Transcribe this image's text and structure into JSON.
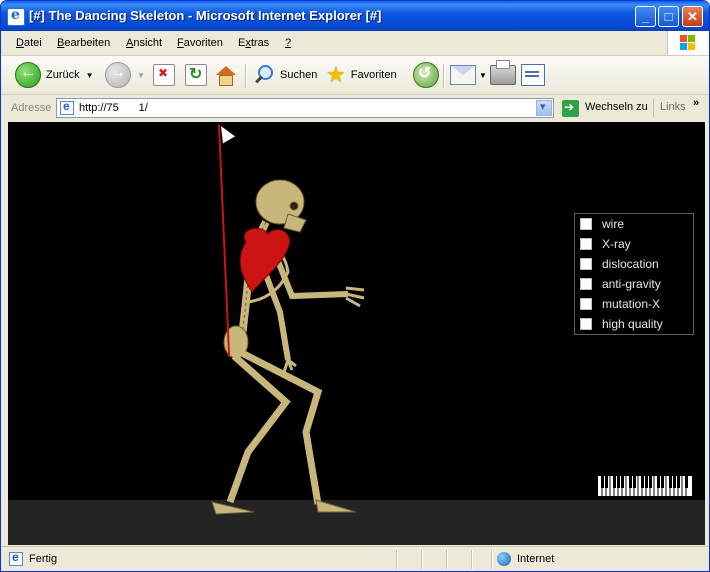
{
  "window": {
    "title": "[#] The Dancing Skeleton - Microsoft Internet Explorer [#]"
  },
  "menu": [
    {
      "label": "Datei",
      "accel": "D"
    },
    {
      "label": "Bearbeiten",
      "accel": "B"
    },
    {
      "label": "Ansicht",
      "accel": "A"
    },
    {
      "label": "Favoriten",
      "accel": "F"
    },
    {
      "label": "Extras",
      "accel": "x"
    },
    {
      "label": "?",
      "accel": "?"
    }
  ],
  "toolbar": {
    "back_label": "Zurück",
    "search_label": "Suchen",
    "favorites_label": "Favoriten"
  },
  "address": {
    "label": "Adresse",
    "url": "http://75         1/",
    "go_label": "Wechseln zu",
    "links_label": "Links"
  },
  "options": [
    {
      "label": "wire",
      "checked": false
    },
    {
      "label": "X-ray",
      "checked": false
    },
    {
      "label": "dislocation",
      "checked": false
    },
    {
      "label": "anti-gravity",
      "checked": false
    },
    {
      "label": "mutation-X",
      "checked": false
    },
    {
      "label": "high quality",
      "checked": false
    }
  ],
  "status": {
    "text": "Fertig",
    "zone": "Internet"
  },
  "colors": {
    "page_background": "#000000",
    "floor": "#242424",
    "heart": "#cc1414",
    "bone": "#c8b67a"
  }
}
